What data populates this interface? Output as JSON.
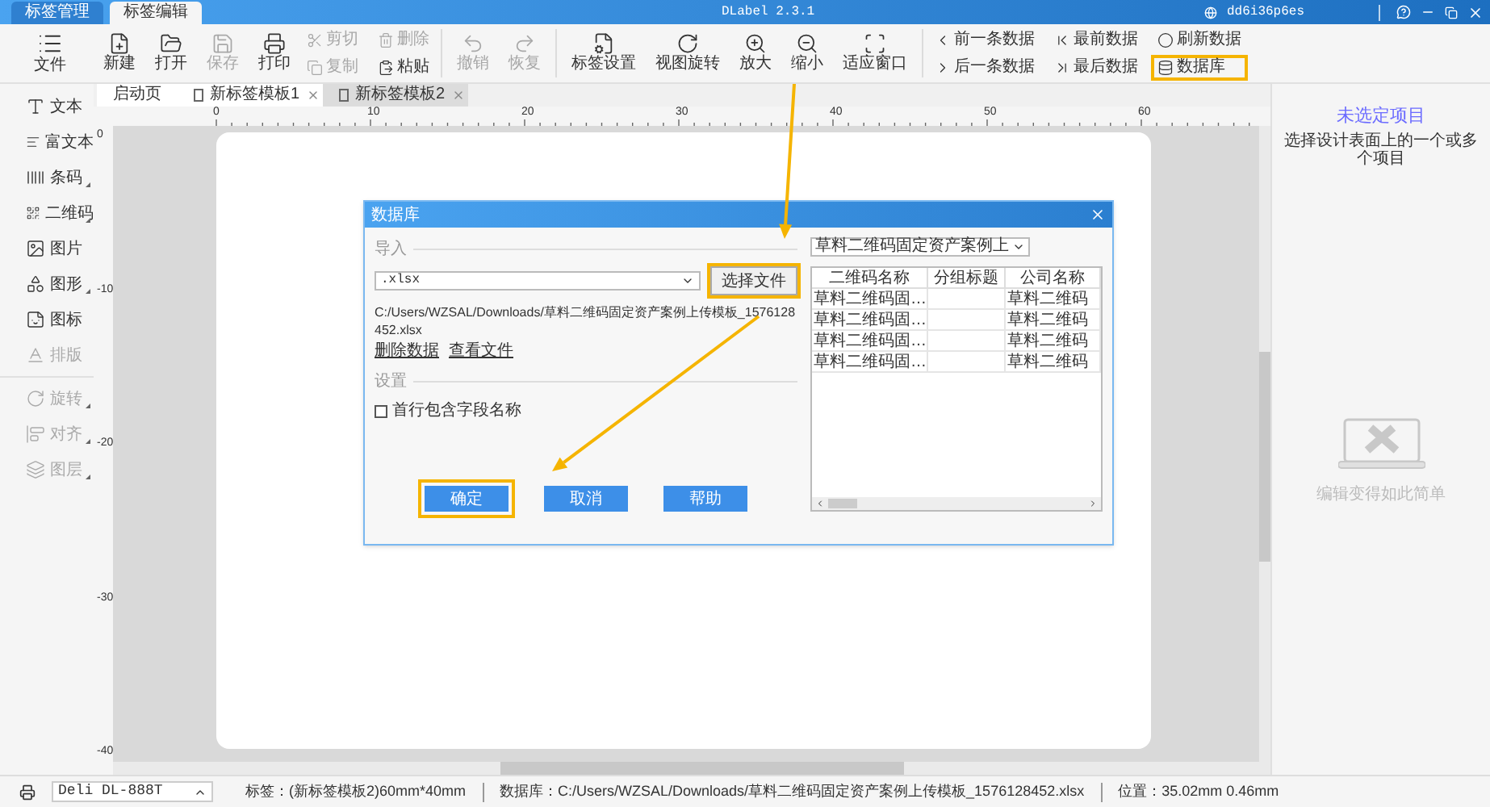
{
  "title_bar": {
    "tabs": [
      {
        "label": "标签管理",
        "selected": false
      },
      {
        "label": "标签编辑",
        "selected": true
      }
    ],
    "app_title": "DLabel 2.3.1",
    "user": "dd6i36p6es"
  },
  "ribbon": {
    "file_button": {
      "label": "文件"
    },
    "groups": [
      {
        "kind": "large",
        "items": [
          {
            "label": "新建",
            "disabled": false,
            "highlighted": false
          },
          {
            "label": "打开",
            "disabled": false,
            "highlighted": false
          },
          {
            "label": "保存",
            "disabled": true,
            "highlighted": false
          },
          {
            "label": "打印",
            "disabled": false,
            "highlighted": false
          }
        ]
      },
      {
        "kind": "small",
        "items": [
          {
            "label": "剪切",
            "disabled": true,
            "highlighted": false
          },
          {
            "label": "复制",
            "disabled": true,
            "highlighted": false
          },
          {
            "label": "删除",
            "disabled": true,
            "highlighted": false
          },
          {
            "label": "粘贴",
            "disabled": false,
            "highlighted": false
          }
        ]
      },
      {
        "kind": "large",
        "items": [
          {
            "label": "撤销",
            "disabled": true,
            "highlighted": false
          },
          {
            "label": "恢复",
            "disabled": true,
            "highlighted": false
          }
        ]
      },
      {
        "kind": "large",
        "items": [
          {
            "label": "标签设置",
            "disabled": false,
            "highlighted": false
          },
          {
            "label": "视图旋转",
            "disabled": false,
            "highlighted": false
          },
          {
            "label": "放大",
            "disabled": false,
            "highlighted": false
          },
          {
            "label": "缩小",
            "disabled": false,
            "highlighted": false
          },
          {
            "label": "适应窗口",
            "disabled": false,
            "highlighted": false
          }
        ]
      },
      {
        "kind": "small",
        "items": [
          {
            "label": "前一条数据",
            "disabled": false,
            "highlighted": false
          },
          {
            "label": "后一条数据",
            "disabled": false,
            "highlighted": false
          },
          {
            "label": "最前数据",
            "disabled": false,
            "highlighted": false
          },
          {
            "label": "最后数据",
            "disabled": false,
            "highlighted": false
          },
          {
            "label": "刷新数据",
            "disabled": false,
            "highlighted": false
          },
          {
            "label": "数据库",
            "disabled": false,
            "highlighted": true
          }
        ]
      }
    ]
  },
  "sidebar": {
    "sections": [
      {
        "items": [
          {
            "label": "文本",
            "disabled": false,
            "has_menu": false
          },
          {
            "label": "富文本",
            "disabled": false,
            "has_menu": false
          },
          {
            "label": "条码",
            "disabled": false,
            "has_menu": true
          },
          {
            "label": "二维码",
            "disabled": false,
            "has_menu": true
          },
          {
            "label": "图片",
            "disabled": false,
            "has_menu": false
          },
          {
            "label": "图形",
            "disabled": false,
            "has_menu": true
          },
          {
            "label": "图标",
            "disabled": false,
            "has_menu": false
          },
          {
            "label": "排版",
            "disabled": true,
            "has_menu": false
          }
        ]
      },
      {
        "items": [
          {
            "label": "旋转",
            "disabled": true,
            "has_menu": true
          },
          {
            "label": "对齐",
            "disabled": true,
            "has_menu": true
          },
          {
            "label": "图层",
            "disabled": true,
            "has_menu": true
          }
        ]
      }
    ]
  },
  "doc_tabs": [
    {
      "label": "启动页",
      "selected": false,
      "closable": false
    },
    {
      "label": "新标签模板1",
      "selected": false,
      "closable": true
    },
    {
      "label": "新标签模板2",
      "selected": true,
      "closable": true
    }
  ],
  "rulers": {
    "horizontal": [
      "0",
      "10",
      "20",
      "30",
      "40",
      "50",
      "60"
    ],
    "vertical": [
      "0",
      "-10",
      "-20",
      "-30",
      "-40"
    ]
  },
  "dialog": {
    "title": "数据库",
    "import_section": "导入",
    "file_type": ".xlsx",
    "choose_button": {
      "label": "选择文件",
      "highlighted": true
    },
    "file_path": "C:/Users/WZSAL/Downloads/草料二维码固定资产案例上传模板_1576128452.xlsx",
    "links": [
      "删除数据",
      "查看文件"
    ],
    "settings_section": "设置",
    "header_checkbox": {
      "label": "首行包含字段名称",
      "checked": false
    },
    "buttons": [
      {
        "label": "确定",
        "highlighted": true
      },
      {
        "label": "取消",
        "highlighted": false
      },
      {
        "label": "帮助",
        "highlighted": false
      }
    ],
    "sheet_select": "草料二维码固定资产案例上",
    "table": {
      "columns": [
        "二维码名称",
        "分组标题",
        "公司名称"
      ],
      "rows": [
        {
          "name": "草料二维码固…",
          "company": "草料二维码"
        },
        {
          "name": "草料二维码固…",
          "company": "草料二维码"
        },
        {
          "name": "草料二维码固…",
          "company": "草料二维码"
        },
        {
          "name": "草料二维码固…",
          "company": "草料二维码"
        }
      ]
    }
  },
  "properties_panel": {
    "title": "未选定项目",
    "subtitle": "选择设计表面上的一个或多个项目",
    "hint": "编辑变得如此简单"
  },
  "status_bar": {
    "printer": "Deli DL-888T",
    "label_info": "标签：(新标签模板2)60mm*40mm",
    "data_source": "数据库：C:/Users/WZSAL/Downloads/草料二维码固定资产案例上传模板_1576128452.xlsx",
    "position": "位置：35.02mm 0.46mm"
  }
}
